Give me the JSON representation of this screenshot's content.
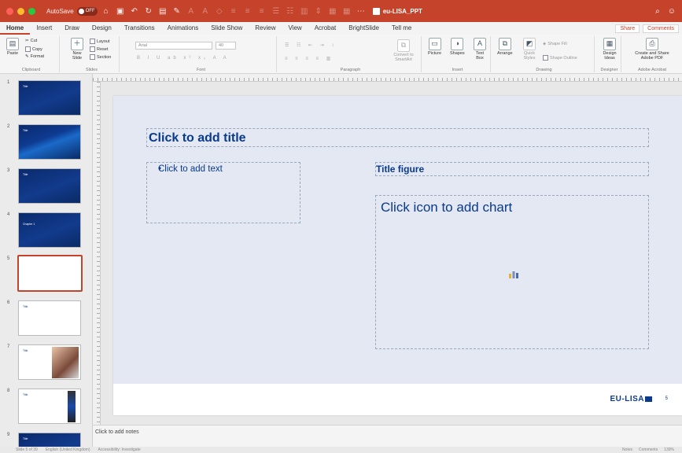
{
  "window": {
    "autosave_label": "AutoSave",
    "autosave_state": "OFF",
    "doc_title": "eu-LISA_PPT",
    "accent": "#c5432b"
  },
  "menu": {
    "tabs": [
      "Home",
      "Insert",
      "Draw",
      "Design",
      "Transitions",
      "Animations",
      "Slide Show",
      "Review",
      "View",
      "Acrobat",
      "BrightSlide",
      "Tell me"
    ],
    "share": "Share",
    "comments": "Comments"
  },
  "ribbon": {
    "clipboard": {
      "paste": "Paste",
      "cut": "Cut",
      "copy": "Copy",
      "format": "Format",
      "label": "Clipboard"
    },
    "slides": {
      "new_slide": "New Slide",
      "layout": "Layout",
      "reset": "Reset",
      "section": "Section",
      "label": "Slides"
    },
    "font": {
      "name": "Arial",
      "size": "40",
      "label": "Font"
    },
    "paragraph": {
      "convert": "Convert to SmartArt",
      "label": "Paragraph"
    },
    "insert": {
      "picture": "Picture",
      "shapes": "Shapes",
      "textbox": "Text Box",
      "label": "Insert"
    },
    "drawing": {
      "arrange": "Arrange",
      "quick_styles": "Quick Styles",
      "shape_fill": "Shape Fill",
      "shape_outline": "Shape Outline",
      "label": "Drawing"
    },
    "designer": {
      "design_ideas": "Design Ideas",
      "label": "Designer"
    },
    "acrobat": {
      "create": "Create and Share Adobe PDF",
      "label": "Adobe Acrobat"
    }
  },
  "thumbnails": [
    {
      "num": "1",
      "style": "blue",
      "text": "Title"
    },
    {
      "num": "2",
      "style": "stripes",
      "text": "Title"
    },
    {
      "num": "3",
      "style": "blue",
      "text": "Title"
    },
    {
      "num": "4",
      "style": "blue",
      "text": "Chapter 1"
    },
    {
      "num": "5",
      "style": "selected",
      "text": ""
    },
    {
      "num": "6",
      "style": "white",
      "text": "Title"
    },
    {
      "num": "7",
      "style": "white",
      "text": "Title"
    },
    {
      "num": "8",
      "style": "white",
      "text": "Title"
    },
    {
      "num": "9",
      "style": "blue",
      "text": "Title"
    }
  ],
  "slide": {
    "title_placeholder": "Click to add title",
    "text_placeholder": "Click to add text",
    "figure_title": "Title figure",
    "chart_placeholder": "Click icon to add chart",
    "logo": "EU-LISA",
    "page_number": "5"
  },
  "notes": {
    "placeholder": "Click to add notes"
  },
  "status": {
    "slide_info": "Slide 5 of 39",
    "language": "English (United Kingdom)",
    "accessibility": "Accessibility: Investigate",
    "notes": "Notes",
    "comments": "Comments",
    "zoom": "139%"
  }
}
